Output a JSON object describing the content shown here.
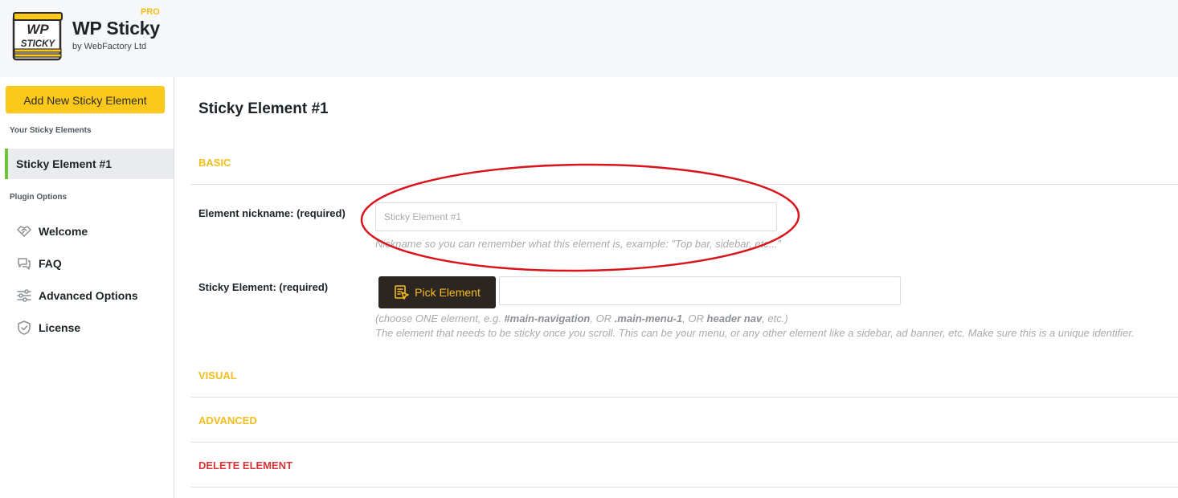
{
  "brand": {
    "logo_line1": "WP",
    "logo_line2": "STICKY",
    "title": "WP Sticky",
    "badge": "PRO",
    "byline": "by WebFactory Ltd",
    "accent_color": "#f5bd1b"
  },
  "sidebar": {
    "add_button": "Add New Sticky Element",
    "section_elements": "Your Sticky Elements",
    "active_element": "Sticky Element #1",
    "section_options": "Plugin Options",
    "items": [
      {
        "label": "Welcome",
        "icon": "handshake-icon"
      },
      {
        "label": "FAQ",
        "icon": "chat-bubbles-icon"
      },
      {
        "label": "Advanced Options",
        "icon": "sliders-icon"
      },
      {
        "label": "License",
        "icon": "shield-check-icon"
      }
    ]
  },
  "main": {
    "title": "Sticky Element #1",
    "basic": {
      "heading": "BASIC",
      "nickname": {
        "label": "Element nickname: (required)",
        "placeholder": "Sticky Element #1",
        "help": "Nickname so you can remember what this element is, example: \"Top bar, sidebar, etc...\""
      },
      "element": {
        "label": "Sticky Element: (required)",
        "pick_button": "Pick Element",
        "value": "",
        "help_prefix": "(choose ONE element, e.g. ",
        "example1": "#main-navigation",
        "sep1": ", OR ",
        "example2": ".main-menu-1",
        "sep2": ", OR ",
        "example3": "header nav",
        "help_suffix": ", etc.)",
        "help2": "The element that needs to be sticky once you scroll. This can be your menu, or any other element like a sidebar, ad banner, etc. Make sure this is a unique identifier."
      }
    },
    "visual_heading": "VISUAL",
    "advanced_heading": "ADVANCED",
    "delete_heading": "DELETE ELEMENT",
    "annotation_color": "#d9141b"
  }
}
